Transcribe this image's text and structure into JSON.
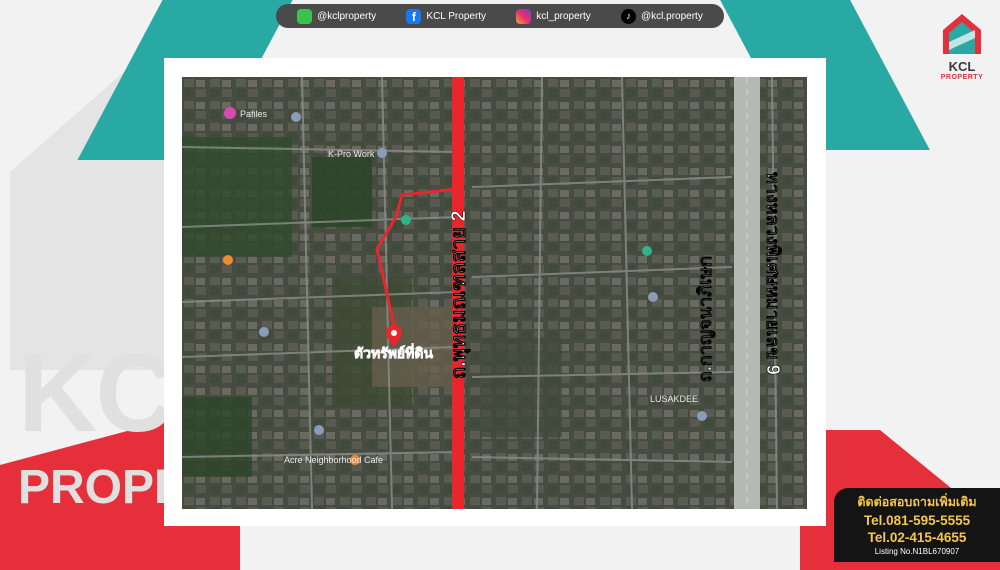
{
  "social": {
    "line": "@kclproperty",
    "facebook": "KCL Property",
    "instagram": "kcl_property",
    "tiktok": "@kcl.property"
  },
  "logo": {
    "name": "KCL",
    "sub": "PROPERTY"
  },
  "watermark": {
    "text1": "KCL",
    "text2": "PROPERTY"
  },
  "map": {
    "road_main": "ถ.พุทธมณฑลสาย 2",
    "road_second": "ถ.กาญจนาภิเษก",
    "road_highway": "ทางหลวงพิเศษหมายเลข 9",
    "property_label": "ตัวทรัพย์ที่ดิน",
    "pois": [
      "Pafiles",
      "K-Pro Work",
      "Acre Neighborhood Cafe",
      "LUSAKDEE"
    ]
  },
  "contact": {
    "title": "ติดต่อสอบถามเพิ่มเติม",
    "tel1": "Tel.081-595-5555",
    "tel2": "Tel.02-415-4655",
    "listing": "Listing No.N1BL670907"
  },
  "colors": {
    "teal": "#29a9a4",
    "red": "#e5303c",
    "route": "#e8262c",
    "gold": "#f4c64a"
  }
}
